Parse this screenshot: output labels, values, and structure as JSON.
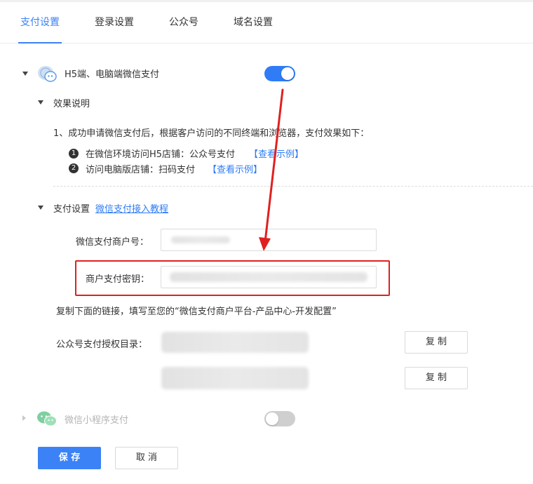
{
  "tabs": [
    {
      "label": "支付设置"
    },
    {
      "label": "登录设置"
    },
    {
      "label": "公众号"
    },
    {
      "label": "域名设置"
    }
  ],
  "section_h5": {
    "title": "H5端、电脑端微信支付",
    "enabled": true,
    "effect": {
      "heading": "效果说明",
      "line1": "1、成功申请微信支付后，根据客户访问的不同终端和浏览器，支付效果如下：",
      "items": [
        {
          "number": "1",
          "text": "在微信环境访问H5店铺：公众号支付",
          "link": "【查看示例】"
        },
        {
          "number": "2",
          "text": "访问电脑版店铺：扫码支付",
          "link": "【查看示例】"
        }
      ]
    },
    "settings": {
      "heading": "支付设置",
      "tutorial_link": "微信支付接入教程",
      "merchant_id_label": "微信支付商户号：",
      "merchant_key_label": "商户支付密钥：",
      "copy_hint": "复制下面的链接，填写至您的“微信支付商户平台-产品中心-开发配置”",
      "auth_dir_label": "公众号支付授权目录：",
      "copy_button": "复 制"
    }
  },
  "section_mini": {
    "title": "微信小程序支付",
    "enabled": false
  },
  "footer": {
    "save": "保 存",
    "cancel": "取 消"
  },
  "colors": {
    "accent": "#2f7cf6",
    "highlight": "#e02020"
  }
}
